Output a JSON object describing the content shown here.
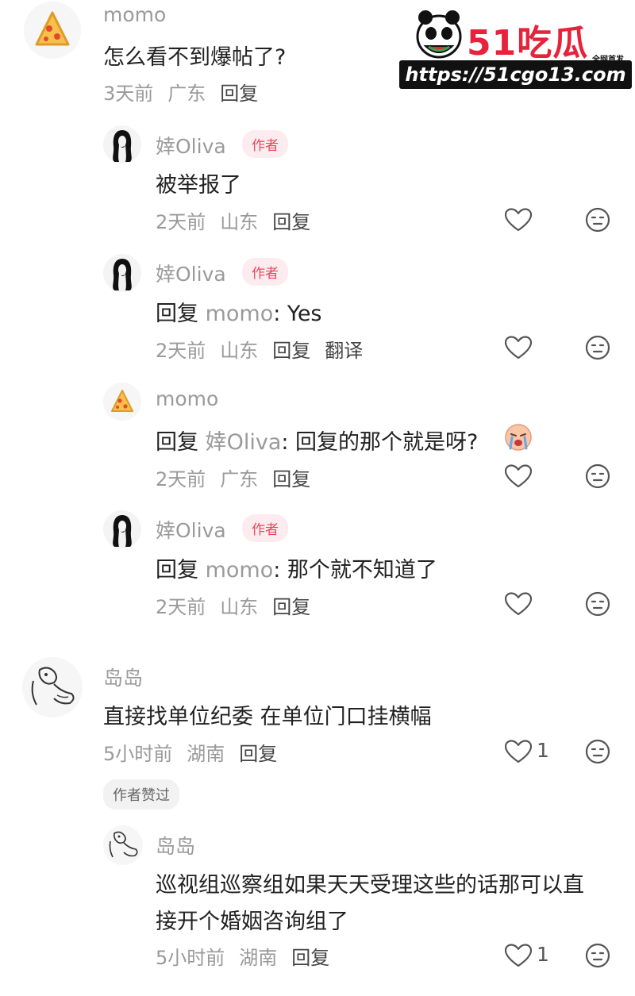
{
  "watermark": {
    "logo_text": "51吃瓜",
    "sub_text": "全网首发",
    "url": "https://51cgo13.com"
  },
  "comments": [
    {
      "user": "momo",
      "avatar": "pizza-avatar",
      "text": "怎么看不到爆帖了?",
      "time": "3天前",
      "location": "广东",
      "reply_label": "回复"
    },
    {
      "user": "婞Oliva",
      "badge": "作者",
      "avatar": "girl-avatar",
      "text": "被举报了",
      "time": "2天前",
      "location": "山东",
      "reply_label": "回复"
    },
    {
      "user": "婞Oliva",
      "badge": "作者",
      "avatar": "girl-avatar",
      "reply_prefix": "回复",
      "reply_to": "momo",
      "text": ": Yes",
      "time": "2天前",
      "location": "山东",
      "reply_label": "回复",
      "translate_label": "翻译"
    },
    {
      "user": "momo",
      "avatar": "pizza-avatar",
      "reply_prefix": "回复",
      "reply_to": "婞Oliva",
      "text": ": 回复的那个就是呀?",
      "emoji": "crying-face-emoji",
      "time": "2天前",
      "location": "广东",
      "reply_label": "回复"
    },
    {
      "user": "婞Oliva",
      "badge": "作者",
      "avatar": "girl-avatar",
      "reply_prefix": "回复",
      "reply_to": "momo",
      "text": ": 那个就不知道了",
      "time": "2天前",
      "location": "山东",
      "reply_label": "回复"
    },
    {
      "user": "岛岛",
      "avatar": "sketch-avatar",
      "text": "直接找单位纪委 在单位门口挂横幅",
      "time": "5小时前",
      "location": "湖南",
      "reply_label": "回复",
      "likes": "1",
      "author_liked_label": "作者赞过"
    },
    {
      "user": "岛岛",
      "avatar": "sketch-avatar",
      "text_line1": "巡视组巡察组如果天天受理这些的话那可以直",
      "text_line2": "接开个婚姻咨询组了",
      "time": "5小时前",
      "location": "湖南",
      "reply_label": "回复",
      "likes": "1"
    }
  ],
  "colors": {
    "author_badge_text": "#e24a5e",
    "author_badge_bg": "#fdecef",
    "watermark_red": "#e8223a"
  }
}
